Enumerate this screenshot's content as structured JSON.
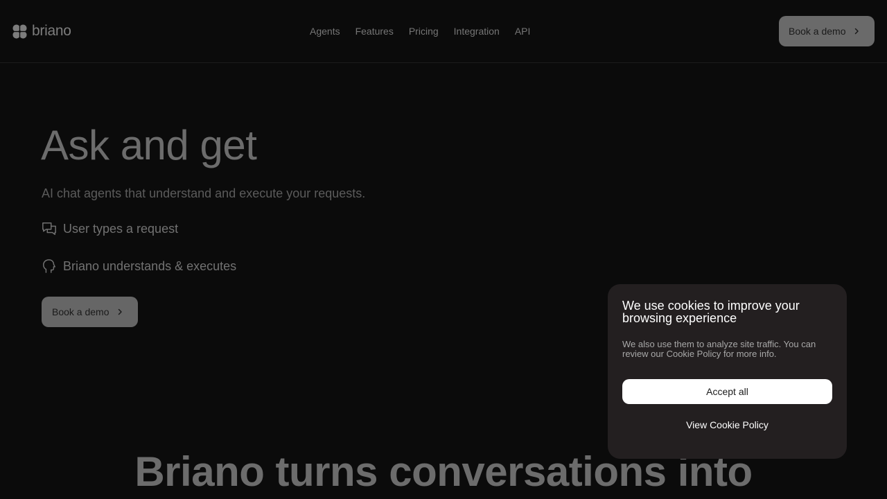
{
  "header": {
    "logo_text": "briano",
    "nav": [
      "Agents",
      "Features",
      "Pricing",
      "Integration",
      "API"
    ],
    "cta_label": "Book a demo"
  },
  "hero": {
    "title": "Ask and get",
    "subtitle": "AI chat agents that understand and execute your requests.",
    "features": [
      {
        "icon": "chat-bubbles-icon",
        "label": "User types a request"
      },
      {
        "icon": "head-icon",
        "label": "Briano understands & executes"
      }
    ],
    "cta_label": "Book a demo"
  },
  "section": {
    "title": "Briano turns conversations into"
  },
  "cookie": {
    "title": "We use cookies to improve your browsing experience",
    "text": "We also use them to analyze site traffic. You can review our Cookie Policy for more info.",
    "accept_label": "Accept all",
    "policy_label": "View Cookie Policy"
  },
  "colors": {
    "background": "#0b0b0b",
    "button_gray": "#6a6a6a",
    "cookie_bg": "#231f20",
    "accept_bg": "#ffffff"
  }
}
